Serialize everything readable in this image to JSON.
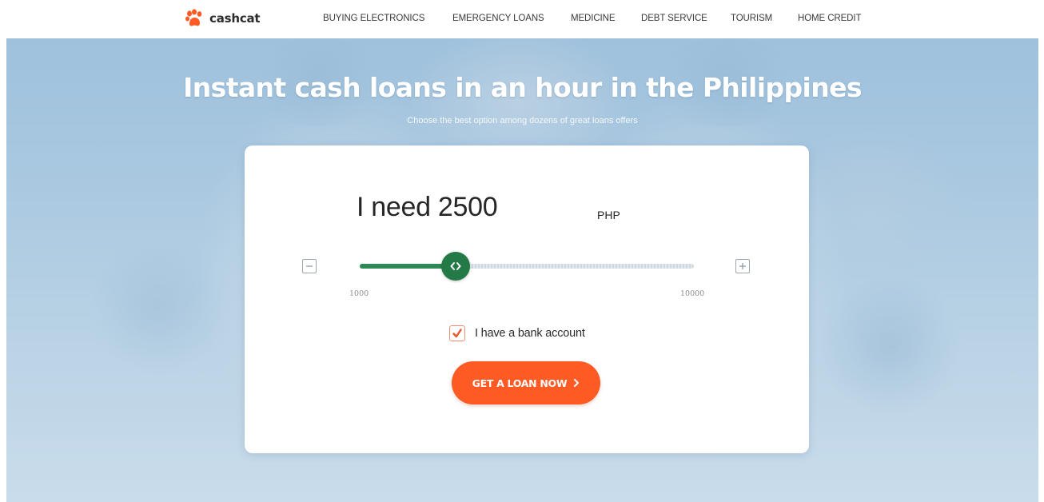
{
  "brand": {
    "name": "cashcat",
    "logo_icon": "paw-icon",
    "accent_color": "#fd5a24",
    "slider_color": "#247a47"
  },
  "nav": {
    "items": [
      {
        "label": "BUYING ELECTRONICS"
      },
      {
        "label": "EMERGENCY LOANS"
      },
      {
        "label": "MEDICINE"
      },
      {
        "label": "DEBT SERVICE"
      },
      {
        "label": "TOURISM"
      },
      {
        "label": "HOME CREDIT"
      }
    ]
  },
  "hero": {
    "title": "Instant cash loans in an hour in the Philippines",
    "subtitle": "Choose the best option among dozens of great loans offers"
  },
  "calculator": {
    "amount_text": "I need 2500",
    "currency": "PHP",
    "min_label": "1000",
    "max_label": "10000",
    "slider": {
      "min": 1000,
      "max": 10000,
      "value": 2500
    },
    "decrease_icon": "minus-icon",
    "increase_icon": "plus-icon",
    "bank_account_checked": true,
    "bank_account_label": "I have a bank account",
    "cta_label": "GET A LOAN NOW",
    "cta_icon": "chevron-right-icon"
  }
}
